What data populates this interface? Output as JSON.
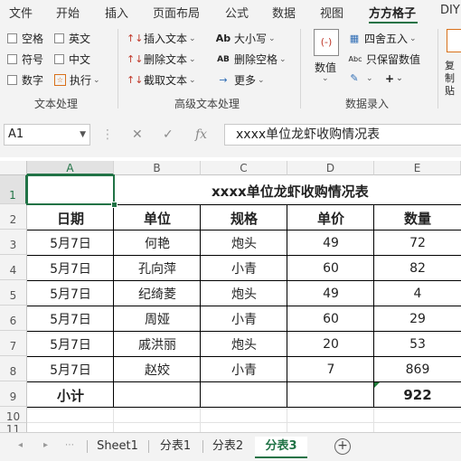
{
  "ribbon_tabs": [
    "文件",
    "开始",
    "插入",
    "页面布局",
    "公式",
    "数据",
    "视图",
    "方方格子",
    "DIY"
  ],
  "active_tab": "方方格子",
  "ribbon": {
    "text_group": {
      "checkboxes": [
        "空格",
        "英文",
        "符号",
        "中文",
        "数字"
      ],
      "exec_label": "执行",
      "label": "文本处理"
    },
    "adv_group": {
      "insert_label": "插入文本",
      "delete_label": "删除文本",
      "cut_label": "截取文本",
      "case_label": "大小写",
      "trim_label": "删除空格",
      "more_label": "更多",
      "label": "高级文本处理"
    },
    "num_group": {
      "number_label": "数值",
      "round_label": "四舍五入",
      "keep_value_label": "只保留数值",
      "label": "数据录入"
    },
    "copy_label": "复制 贴"
  },
  "name_box": "A1",
  "formula": "xxxx单位龙虾收购情况表",
  "columns": [
    "A",
    "B",
    "C",
    "D",
    "E"
  ],
  "rows": [
    "1",
    "2",
    "3",
    "4",
    "5",
    "6",
    "7",
    "8",
    "9",
    "10",
    "11"
  ],
  "table": {
    "title": "xxxx单位龙虾收购情况表",
    "headers": [
      "日期",
      "单位",
      "规格",
      "单价",
      "数量"
    ],
    "data": [
      [
        "5月7日",
        "何艳",
        "炮头",
        "49",
        "72"
      ],
      [
        "5月7日",
        "孔向萍",
        "小青",
        "60",
        "82"
      ],
      [
        "5月7日",
        "纪绮菱",
        "炮头",
        "49",
        "4"
      ],
      [
        "5月7日",
        "周娅",
        "小青",
        "60",
        "29"
      ],
      [
        "5月7日",
        "戚洪丽",
        "炮头",
        "20",
        "53"
      ],
      [
        "5月7日",
        "赵姣",
        "小青",
        "7",
        "869"
      ]
    ],
    "total_label": "小计",
    "total_value": "922"
  },
  "sheets": [
    "Sheet1",
    "分表1",
    "分表2",
    "分表3"
  ],
  "active_sheet": "分表3",
  "colors": {
    "accent": "#217346",
    "error_marker": "#1e7a3a"
  }
}
